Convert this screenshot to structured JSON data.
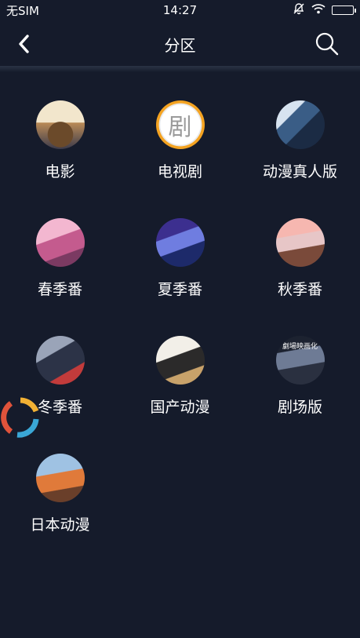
{
  "status_bar": {
    "carrier": "无SIM",
    "time": "14:27",
    "icons": [
      "mute-icon",
      "wifi-icon",
      "battery-icon"
    ]
  },
  "nav": {
    "title": "分区",
    "back_icon": "chevron-left-icon",
    "search_icon": "search-icon"
  },
  "categories": [
    {
      "label": "电影"
    },
    {
      "label": "电视剧",
      "thumb_text": "剧"
    },
    {
      "label": "动漫真人版"
    },
    {
      "label": "春季番"
    },
    {
      "label": "夏季番"
    },
    {
      "label": "秋季番"
    },
    {
      "label": "冬季番"
    },
    {
      "label": "国产动漫"
    },
    {
      "label": "剧场版",
      "thumb_text": "劇場映画化"
    },
    {
      "label": "日本动漫"
    }
  ],
  "colors": {
    "background": "#151b2b",
    "text": "#ffffff",
    "loader": [
      "#e0533b",
      "#f2b134",
      "#3aa7d6"
    ]
  }
}
